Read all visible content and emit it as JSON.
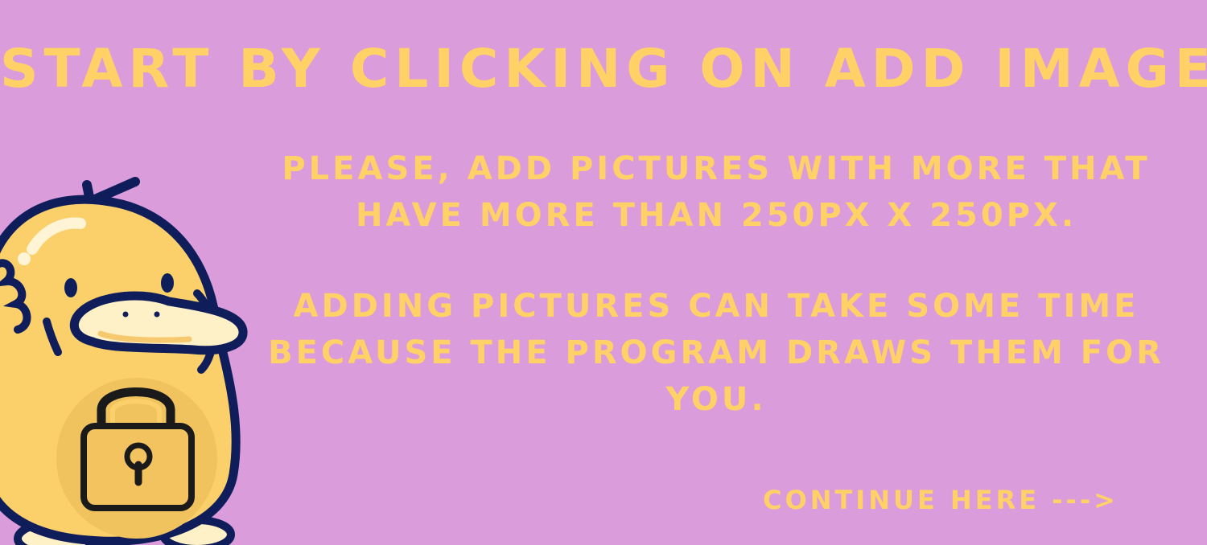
{
  "heading": "Start by clicking on add image",
  "info": {
    "size_note": "Please, add pictures with more that have more than 250px x 250px.",
    "time_note": "Adding pictures can take some time because the program draws them for you."
  },
  "continue_link": "Continue here --->",
  "mascot": {
    "icon": "duck-with-padlock-illustration"
  },
  "colors": {
    "background": "#da9cda",
    "text": "#ffd166",
    "duck_body": "#fbd06a",
    "outline": "#0f1d5b"
  }
}
